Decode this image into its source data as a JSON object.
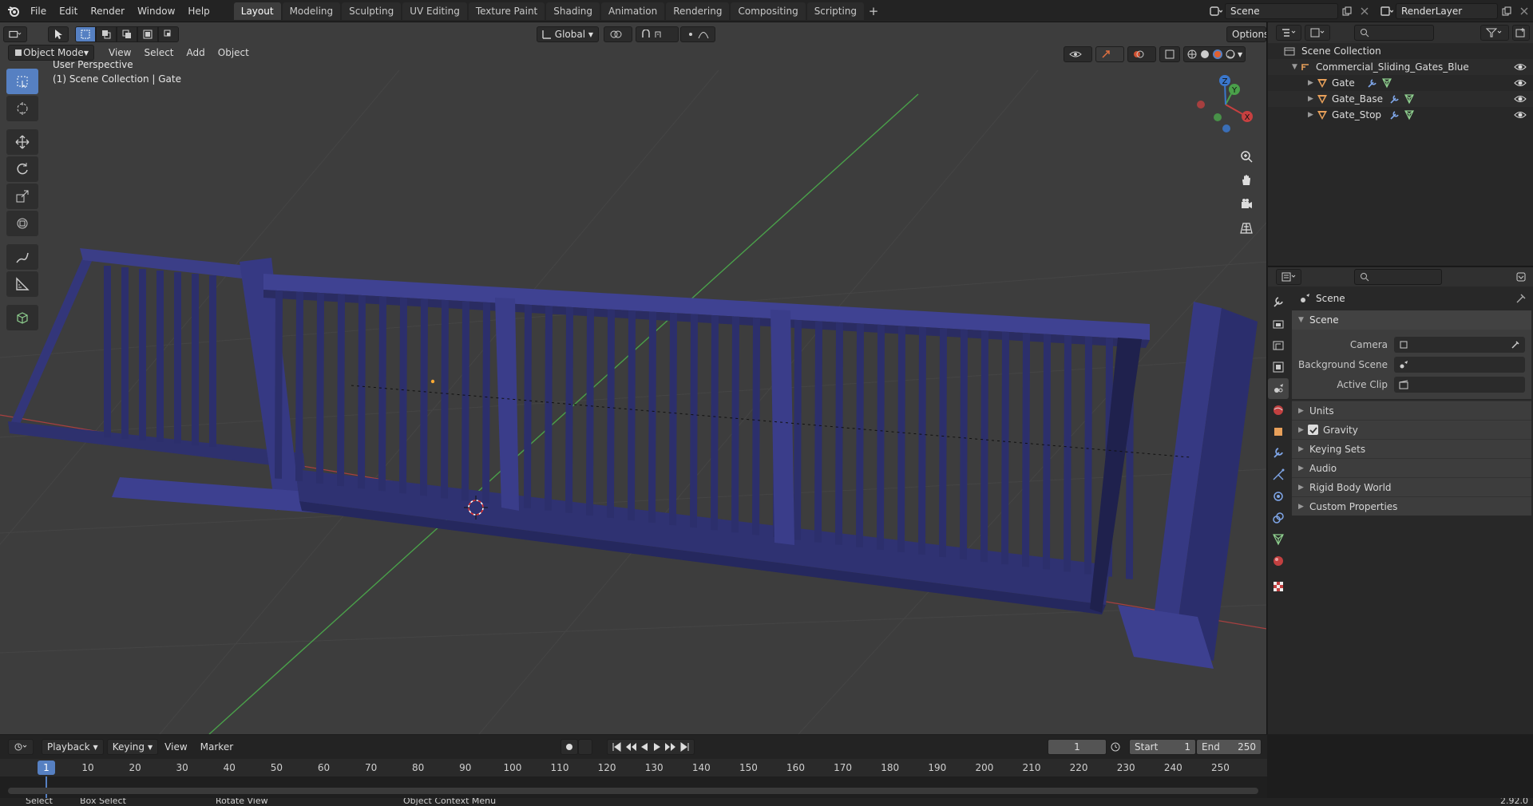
{
  "menu": [
    "File",
    "Edit",
    "Render",
    "Window",
    "Help"
  ],
  "workspaces": [
    "Layout",
    "Modeling",
    "Sculpting",
    "UV Editing",
    "Texture Paint",
    "Shading",
    "Animation",
    "Rendering",
    "Compositing",
    "Scripting"
  ],
  "active_workspace": "Layout",
  "top_right": {
    "scene": "Scene",
    "view_layer": "RenderLayer"
  },
  "viewport": {
    "mode": "Object Mode",
    "menus": [
      "View",
      "Select",
      "Add",
      "Object"
    ],
    "orientation": "Global",
    "options_label": "Options",
    "info_line1": "User Perspective",
    "info_line2": "(1) Scene Collection | Gate",
    "gizmo": {
      "x": "X",
      "y": "Y",
      "z": "Z"
    }
  },
  "outliner": {
    "root": "Scene Collection",
    "collection": "Commercial_Sliding_Gates_Blue",
    "objects": [
      "Gate",
      "Gate_Base",
      "Gate_Stop"
    ]
  },
  "properties": {
    "breadcrumb": "Scene",
    "panel_title": "Scene",
    "fields": [
      {
        "label": "Camera",
        "value": ""
      },
      {
        "label": "Background Scene",
        "value": ""
      },
      {
        "label": "Active Clip",
        "value": ""
      }
    ],
    "subpanels": [
      "Units",
      "Gravity",
      "Keying Sets",
      "Audio",
      "Rigid Body World",
      "Custom Properties"
    ],
    "gravity_checked": true
  },
  "timeline": {
    "menus": [
      "Playback",
      "Keying",
      "View",
      "Marker"
    ],
    "current_frame": "1",
    "start_label": "Start",
    "start": "1",
    "end_label": "End",
    "end": "250",
    "ruler": [
      "10",
      "20",
      "30",
      "40",
      "50",
      "60",
      "70",
      "80",
      "90",
      "100",
      "110",
      "120",
      "130",
      "140",
      "150",
      "160",
      "170",
      "180",
      "190",
      "200",
      "210",
      "220",
      "230",
      "240",
      "250"
    ],
    "playhead_label": "1"
  },
  "status": {
    "select": "Select",
    "box_select": "Box Select",
    "rotate": "Rotate View",
    "context": "Object Context Menu",
    "version": "2.92.0"
  },
  "colors": {
    "accent": "#5680c2",
    "gate": "#3b3e87",
    "x_axis": "#c74040",
    "y_axis": "#4aa04a",
    "z_axis": "#3a77cc"
  }
}
